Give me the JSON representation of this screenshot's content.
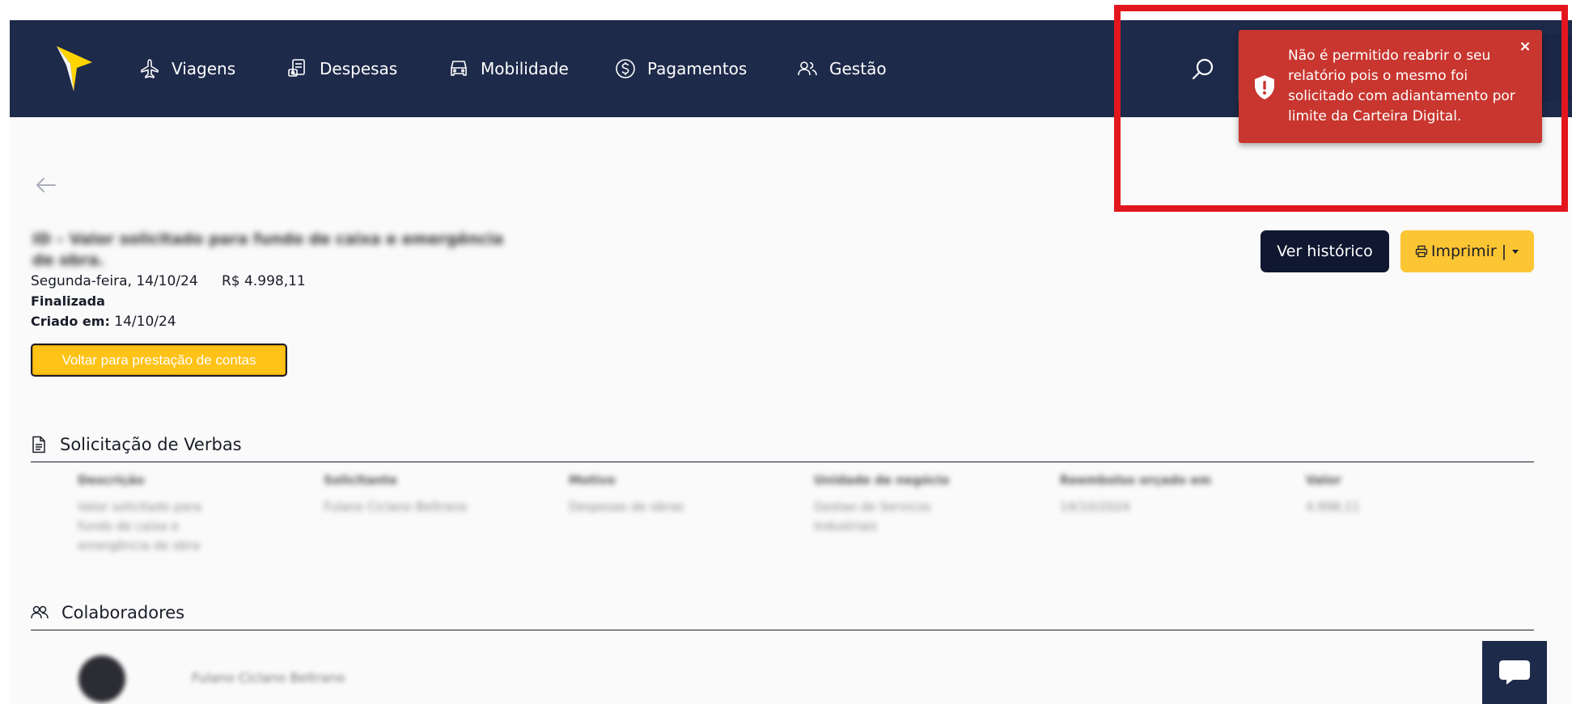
{
  "nav": {
    "items": [
      {
        "label": "Viagens",
        "icon": "airplane-icon"
      },
      {
        "label": "Despesas",
        "icon": "receipt-icon"
      },
      {
        "label": "Mobilidade",
        "icon": "car-icon"
      },
      {
        "label": "Pagamentos",
        "icon": "dollar-coin-icon"
      },
      {
        "label": "Gestão",
        "icon": "users-icon"
      }
    ]
  },
  "toast": {
    "message": "Não é permitido reabrir o seu relatório pois o mesmo foi solicitado com adiantamento por limite da Carteira Digital.",
    "close": "×"
  },
  "report": {
    "title": "ID – Valor solicitado para fundo de caixa e emergência de obra.",
    "date": "Segunda-feira, 14/10/24",
    "amount": "R$ 4.998,11",
    "status": "Finalizada",
    "created_label": "Criado em:",
    "created_value": "14/10/24",
    "back_button": "Voltar para prestação de contas"
  },
  "actions": {
    "history": "Ver histórico",
    "print": "Imprimir |"
  },
  "sections": {
    "verbas": "Solicitação de Verbas",
    "colaboradores": "Colaboradores"
  },
  "verbas_table": {
    "headers": [
      "Descrição",
      "Solicitante",
      "Motivo",
      "Unidade de negócio",
      "Reembolso orçado em",
      "Valor"
    ],
    "cells": [
      "Valor solicitado para fundo de caixa e emergência de obra",
      "Fulano Ciclano Beltrano",
      "Despesas de obras",
      "Gestao de Servicos Industriais",
      "14/10/2024",
      "4.998,11"
    ]
  },
  "colaboradores": {
    "name": "Fulano Ciclano Beltrano"
  }
}
